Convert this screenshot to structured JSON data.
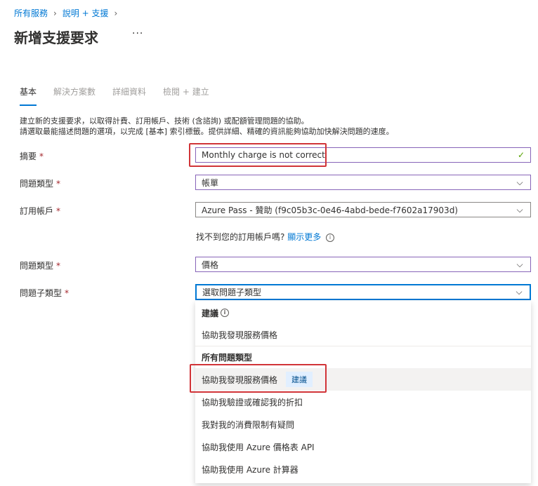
{
  "breadcrumb": {
    "items": [
      "所有服務",
      "說明 + 支援"
    ]
  },
  "page": {
    "title": "新增支援要求",
    "more": "···"
  },
  "tabs": [
    {
      "label": "基本",
      "active": true
    },
    {
      "label": "解決方案數",
      "active": false
    },
    {
      "label": "詳細資料",
      "active": false
    },
    {
      "label": "檢閱 + 建立",
      "active": false
    }
  ],
  "description": {
    "line1": "建立新的支援要求，以取得計費、訂用帳戶、技術 (含諮詢) 或配額管理問題的協助。",
    "line2": "請選取最能描述問題的選項，以完成 [基本] 索引標籤。提供詳細、精確的資訊能夠協助加快解決問題的速度。"
  },
  "form": {
    "summary": {
      "label": "摘要",
      "value": "Monthly charge is not correct"
    },
    "issue_type": {
      "label": "問題類型",
      "value": "帳單"
    },
    "subscription": {
      "label": "訂用帳戶",
      "value": "Azure Pass - 贊助 (f9c05b3c-0e46-4abd-bede-f7602a17903d)"
    },
    "hint": {
      "text": "找不到您的訂用帳戶嗎?",
      "link": "顯示更多"
    },
    "problem_type": {
      "label": "問題類型",
      "value": "價格"
    },
    "problem_subtype": {
      "label": "問題子類型",
      "placeholder": "選取問題子類型"
    },
    "required_mark": "*"
  },
  "dropdown": {
    "suggested_header": "建議",
    "suggested_items": [
      "協助我發現服務價格"
    ],
    "all_header": "所有問題類型",
    "items": [
      {
        "label": "協助我發現服務價格",
        "badge": "建議"
      },
      {
        "label": "協助我驗證或確認我的折扣"
      },
      {
        "label": "我對我的消費限制有疑問"
      },
      {
        "label": "協助我使用 Azure 價格表 API"
      },
      {
        "label": "協助我使用 Azure 計算器"
      }
    ]
  },
  "colors": {
    "accent": "#0078d4",
    "highlight": "#d13438",
    "required": "#a4262c",
    "valid": "#57a300"
  },
  "icons": [
    "chevron-right-icon",
    "chevron-down-icon",
    "check-icon",
    "info-icon"
  ]
}
